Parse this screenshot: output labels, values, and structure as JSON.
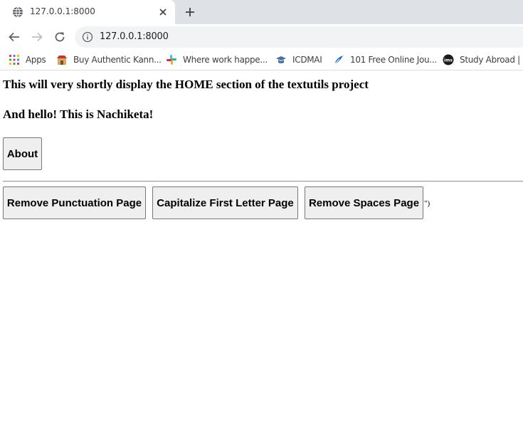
{
  "browser": {
    "tab": {
      "title": "127.0.0.1:8000",
      "favicon": "globe-icon"
    },
    "new_tab_label": "+",
    "address_bar": {
      "url": "127.0.0.1:8000"
    },
    "bookmarks": [
      {
        "label": "Apps",
        "icon": "apps-grid-icon"
      },
      {
        "label": "Buy Authentic Kann...",
        "icon": "shop-icon"
      },
      {
        "label": "Where work happe...",
        "icon": "slack-icon"
      },
      {
        "label": "ICDMAI",
        "icon": "graduation-icon"
      },
      {
        "label": "101 Free Online Jou...",
        "icon": "feather-icon"
      },
      {
        "label": "Study Abroad | U",
        "icon": "ims-icon"
      }
    ]
  },
  "page": {
    "heading1": "This will very shortly display the HOME section of the textutils project",
    "heading2": "And hello! This is Nachiketa!",
    "about_button": "About",
    "buttons": [
      "Remove Punctuation Page",
      "Capitalize First Letter Page",
      "Remove Spaces Page"
    ],
    "stray_text": "\")"
  },
  "colors": {
    "tabstrip_bg": "#dee1e6",
    "omnibox_bg": "#f1f3f4",
    "button_bg": "#efefef",
    "button_border": "#767676"
  }
}
